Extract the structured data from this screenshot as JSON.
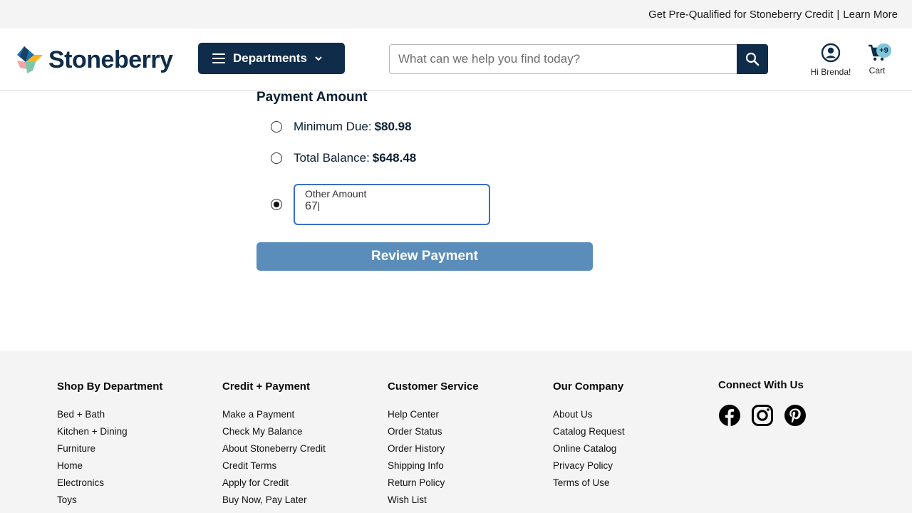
{
  "promo": {
    "prequal_text": "Get Pre-Qualified for Stoneberry Credit",
    "separator": "|",
    "learn_more": "Learn More"
  },
  "header": {
    "logo_text": "Stoneberry",
    "departments_label": "Departments",
    "search_placeholder": "What can we help you find today?",
    "account_label": "Hi Brenda!",
    "cart_label": "Cart",
    "cart_badge": "+9"
  },
  "payment": {
    "title": "Payment Amount",
    "options": [
      {
        "label": "Minimum Due:",
        "amount": "$80.98",
        "selected": false
      },
      {
        "label": "Total Balance:",
        "amount": "$648.48",
        "selected": false
      },
      {
        "label": "Other Amount",
        "value": "67",
        "selected": true
      }
    ],
    "review_button": "Review Payment"
  },
  "footer": {
    "columns": [
      {
        "title": "Shop By Department",
        "links": [
          "Bed + Bath",
          "Kitchen + Dining",
          "Furniture",
          "Home",
          "Electronics",
          "Toys"
        ]
      },
      {
        "title": "Credit + Payment",
        "links": [
          "Make a Payment",
          "Check My Balance",
          "About Stoneberry Credit",
          "Credit Terms",
          "Apply for Credit",
          "Buy Now, Pay Later"
        ]
      },
      {
        "title": "Customer Service",
        "links": [
          "Help Center",
          "Order Status",
          "Order History",
          "Shipping Info",
          "Return Policy",
          "Wish List"
        ]
      },
      {
        "title": "Our Company",
        "links": [
          "About Us",
          "Catalog Request",
          "Online Catalog",
          "Privacy Policy",
          "Terms of Use"
        ]
      }
    ],
    "social_title": "Connect With Us",
    "social_icons": [
      "facebook-icon",
      "instagram-icon",
      "pinterest-icon"
    ]
  },
  "colors": {
    "navy": "#0f2c4a",
    "review_button": "#5b8dba",
    "focus_border": "#3a6fc4",
    "cart_badge": "#7fc6d9",
    "footer_bg": "#f4f4f4"
  }
}
